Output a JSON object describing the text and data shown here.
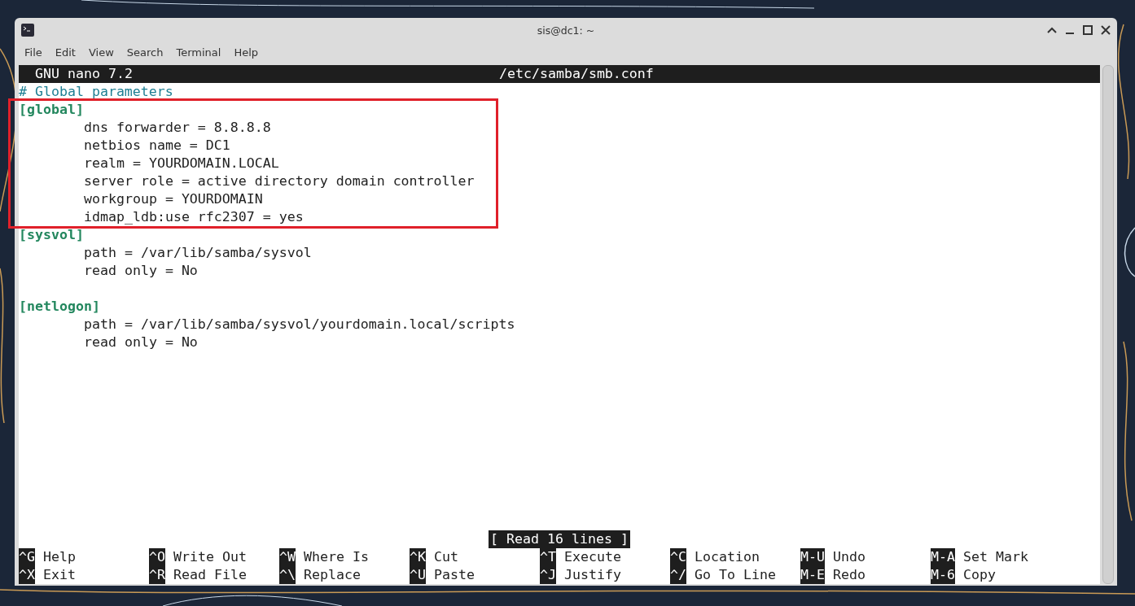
{
  "window": {
    "title": "sis@dc1: ~"
  },
  "menu": [
    "File",
    "Edit",
    "View",
    "Search",
    "Terminal",
    "Help"
  ],
  "nano": {
    "version": "GNU nano 7.2",
    "filename": "/etc/samba/smb.conf"
  },
  "lines": [
    {
      "kind": "comment",
      "text": "# Global parameters"
    },
    {
      "kind": "section",
      "text": "[global]"
    },
    {
      "kind": "setting",
      "text": "dns forwarder = 8.8.8.8"
    },
    {
      "kind": "setting",
      "text": "netbios name = DC1"
    },
    {
      "kind": "setting",
      "text": "realm = YOURDOMAIN.LOCAL"
    },
    {
      "kind": "setting",
      "text": "server role = active directory domain controller"
    },
    {
      "kind": "setting",
      "text": "workgroup = YOURDOMAIN"
    },
    {
      "kind": "setting",
      "text": "idmap_ldb:use rfc2307 = yes"
    },
    {
      "kind": "section",
      "text": "[sysvol]"
    },
    {
      "kind": "setting",
      "text": "path = /var/lib/samba/sysvol"
    },
    {
      "kind": "setting",
      "text": "read only = No"
    },
    {
      "kind": "blank"
    },
    {
      "kind": "section",
      "text": "[netlogon]"
    },
    {
      "kind": "setting",
      "text": "path = /var/lib/samba/sysvol/yourdomain.local/scripts"
    },
    {
      "kind": "setting",
      "text": "read only = No"
    }
  ],
  "status": "[ Read 16 lines ]",
  "shortcuts": [
    [
      {
        "key": "^G",
        "label": "Help"
      },
      {
        "key": "^O",
        "label": "Write Out"
      },
      {
        "key": "^W",
        "label": "Where Is"
      },
      {
        "key": "^K",
        "label": "Cut"
      },
      {
        "key": "^T",
        "label": "Execute"
      },
      {
        "key": "^C",
        "label": "Location"
      },
      {
        "key": "M-U",
        "label": "Undo"
      },
      {
        "key": "M-A",
        "label": "Set Mark"
      }
    ],
    [
      {
        "key": "^X",
        "label": "Exit"
      },
      {
        "key": "^R",
        "label": "Read File"
      },
      {
        "key": "^\\",
        "label": "Replace"
      },
      {
        "key": "^U",
        "label": "Paste"
      },
      {
        "key": "^J",
        "label": "Justify"
      },
      {
        "key": "^/",
        "label": "Go To Line"
      },
      {
        "key": "M-E",
        "label": "Redo"
      },
      {
        "key": "M-6",
        "label": "Copy"
      }
    ]
  ]
}
